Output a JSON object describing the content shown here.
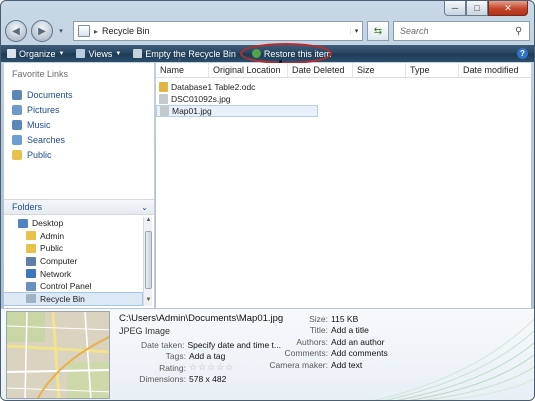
{
  "window": {
    "caption": {
      "minimize": "─",
      "maximize": "□",
      "close": "✕"
    }
  },
  "address_bar": {
    "path": "Recycle Bin",
    "separator": "▸",
    "search_placeholder": "Search"
  },
  "toolbar": {
    "organize": "Organize",
    "views": "Views",
    "empty_recycle_bin": "Empty the Recycle Bin",
    "restore": "Restore this item",
    "help": "?"
  },
  "nav_pane": {
    "favorites_title": "Favorite Links",
    "favorites": [
      {
        "label": "Documents",
        "icon": "documents-icon",
        "color": "#5b86b8"
      },
      {
        "label": "Pictures",
        "icon": "pictures-icon",
        "color": "#6d9ac9"
      },
      {
        "label": "Music",
        "icon": "music-icon",
        "color": "#5b86b8"
      },
      {
        "label": "Searches",
        "icon": "searches-icon",
        "color": "#6a9fd1"
      },
      {
        "label": "Public",
        "icon": "public-folder-icon",
        "color": "#e8c14a"
      }
    ],
    "folders_title": "Folders",
    "tree": [
      {
        "label": "Desktop",
        "level": 0,
        "icon": "desktop-icon",
        "color": "#4f83c4"
      },
      {
        "label": "Admin",
        "level": 1,
        "icon": "user-folder-icon",
        "color": "#e8c14a"
      },
      {
        "label": "Public",
        "level": 1,
        "icon": "folder-icon",
        "color": "#e8c14a"
      },
      {
        "label": "Computer",
        "level": 1,
        "icon": "computer-icon",
        "color": "#5b7fa8"
      },
      {
        "label": "Network",
        "level": 1,
        "icon": "network-icon",
        "color": "#3f78b8"
      },
      {
        "label": "Control Panel",
        "level": 1,
        "icon": "control-panel-icon",
        "color": "#6b8fbf"
      },
      {
        "label": "Recycle Bin",
        "level": 1,
        "icon": "recycle-bin-icon",
        "color": "#9fb3c6",
        "selected": true
      }
    ]
  },
  "columns": [
    "Name",
    "Original Location",
    "Date Deleted",
    "Size",
    "Type",
    "Date modified"
  ],
  "files": [
    {
      "name": "Database1 Table2.odc",
      "icon": "odc-file-icon",
      "color": "#e3b447"
    },
    {
      "name": "DSC01092s.jpg",
      "icon": "jpg-file-icon",
      "color": "#c5c9cd"
    },
    {
      "name": "Map01.jpg",
      "icon": "jpg-file-icon",
      "color": "#c5c9cd",
      "selected": true
    }
  ],
  "details": {
    "filename": "C:\\Users\\Admin\\Documents\\Map01.jpg",
    "filetype": "JPEG Image",
    "left": [
      {
        "label": "Date taken:",
        "value": "Specify date and time t..."
      },
      {
        "label": "Tags:",
        "value": "Add a tag"
      },
      {
        "label": "Rating:",
        "value": "☆☆☆☆☆"
      },
      {
        "label": "Dimensions:",
        "value": "578 x 482"
      }
    ],
    "right": [
      {
        "label": "Size:",
        "value": "115 KB"
      },
      {
        "label": "Title:",
        "value": "Add a title"
      },
      {
        "label": "Authors:",
        "value": "Add an author"
      },
      {
        "label": "Comments:",
        "value": "Add comments"
      },
      {
        "label": "Camera maker:",
        "value": "Add text"
      }
    ],
    "rating_stars": 0
  },
  "colors": {
    "toolbar_bg": "#27445f",
    "link_blue": "#1f4d8c",
    "highlight_ring": "#c12a2a"
  }
}
